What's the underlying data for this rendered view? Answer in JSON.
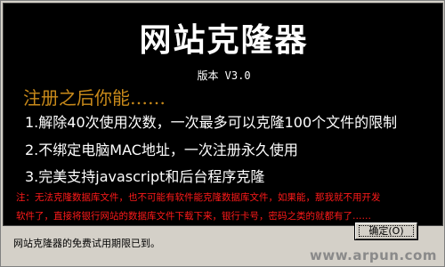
{
  "splash": {
    "app_title": "网站克隆器",
    "version": "版本 V3.0",
    "heading": "注册之后你能……",
    "features": [
      "1.解除40次使用次数，一次最多可以克隆100个文件的限制",
      "2.不绑定电脑MAC地址，一次注册永久使用",
      "3.完美支持javascript和后台程序克隆"
    ],
    "note_lines": [
      "注：无法克隆数据库文件，也不可能有软件能克隆数据库文件，如果能，那我就不用开发",
      "软件了，直接将银行网站的数据库文件下载下来，银行卡号，密码之类的就都有了……"
    ]
  },
  "status_text": "网站克隆器的免费试用期限已到。",
  "ok_button_label": "确定(O)",
  "watermark": "www.arpun.com",
  "colors": {
    "splash_bg": "#000000",
    "heading": "#c98a1a",
    "note": "#ff1a1a",
    "dialog_bg": "#d4d0c8"
  }
}
